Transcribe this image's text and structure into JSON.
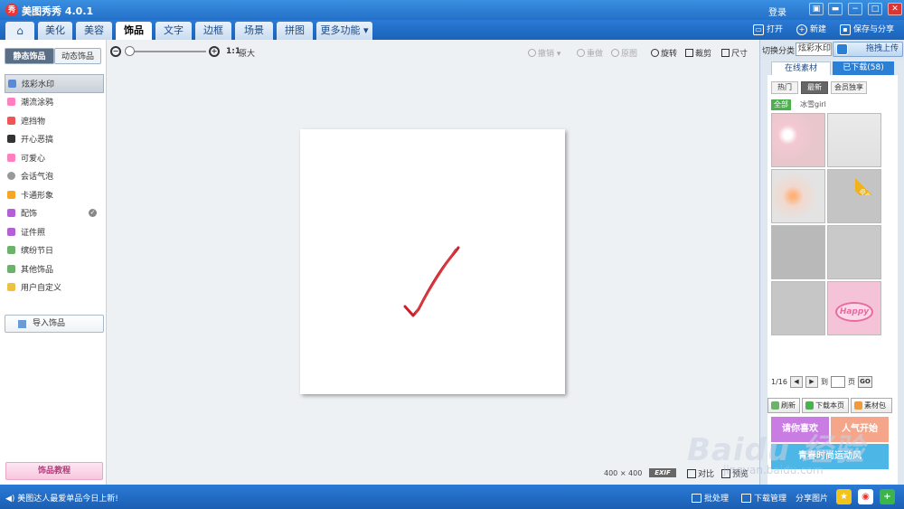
{
  "titlebar": {
    "app_logo": "秀",
    "title": "美图秀秀 4.0.1",
    "login": "登录",
    "window_buttons": [
      "▣",
      "▬",
      "−",
      "□",
      "✕"
    ]
  },
  "menu": {
    "tabs": [
      "美化",
      "美容",
      "饰品",
      "文字",
      "边框",
      "场景",
      "拼图",
      "更多功能 ▾"
    ],
    "active_tab": "饰品",
    "actions": {
      "open": "打开",
      "new": "新建",
      "save_share": "保存与分享"
    }
  },
  "left_panel": {
    "subtabs": [
      "静态饰品",
      "动态饰品"
    ],
    "categories": [
      "炫彩水印",
      "潮流涂鸦",
      "遮挡物",
      "开心恶搞",
      "可爱心",
      "会话气泡",
      "卡通形象",
      "配饰",
      "证件照",
      "缤纷节日",
      "其他饰品",
      "用户自定义"
    ],
    "active_category": "炫彩水印",
    "import_label": "导入饰品",
    "tutorial_label": "饰品教程"
  },
  "toolbar": {
    "zoom_ratio": "1:1",
    "original_size": "原大",
    "undo": "撤销",
    "redo": "重做",
    "original": "原图",
    "rotate": "旋转",
    "crop": "裁剪",
    "resize": "尺寸"
  },
  "canvas": {
    "size_label": "400 × 400",
    "exif": "EXIF",
    "compare": "对比",
    "preview": "预览"
  },
  "right_panel": {
    "switch_label": "切换分类",
    "switch_value": "炫彩水印",
    "upload_label": "拖拽上传",
    "tabs": [
      "在线素材",
      "已下载(58)"
    ],
    "filters": [
      "热门",
      "最新",
      "会员独享"
    ],
    "active_filter": "最新",
    "tags": [
      "全部",
      "冰雪girl"
    ],
    "vip_badge": "会员",
    "happy_text": "Happy",
    "pager": {
      "page": "1/16",
      "prev": "◀",
      "next": "▶",
      "to": "到",
      "unit": "页",
      "go": "GO"
    },
    "actions": [
      "刷新",
      "下载本页",
      "素材包"
    ],
    "promos": [
      "请你喜欢",
      "人气开始",
      "青春时尚运动风"
    ]
  },
  "statusbar": {
    "news": "美图达人最爱单品今日上新!",
    "batch": "批处理",
    "downloads": "下载管理",
    "share": "分享图片"
  },
  "watermark": {
    "brand": "Baidu 经验",
    "url": "jingyan.baidu.com"
  },
  "colors": {
    "accent": "#2b7fd4",
    "checkmark": "#cc1f2a",
    "titlebar": "#2470c8"
  }
}
